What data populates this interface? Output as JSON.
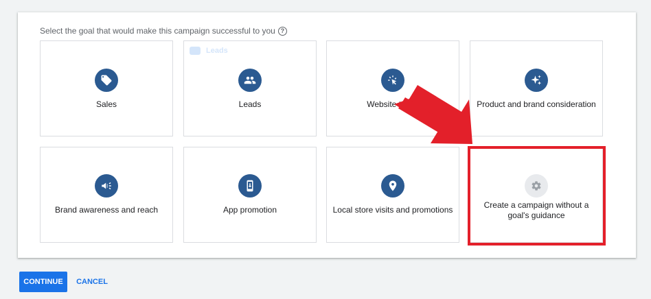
{
  "prompt": {
    "text": "Select the goal that would make this campaign successful to you",
    "help_icon": "help-circle-icon"
  },
  "goals": [
    {
      "label": "Sales",
      "icon": "tag-icon"
    },
    {
      "label": "Leads",
      "icon": "people-icon",
      "hover_preview": {
        "title": "Leads"
      }
    },
    {
      "label": "Website traffic",
      "icon": "cursor-click-icon"
    },
    {
      "label": "Product and brand consideration",
      "icon": "sparkle-icon"
    },
    {
      "label": "Brand awareness and reach",
      "icon": "megaphone-icon"
    },
    {
      "label": "App promotion",
      "icon": "phone-download-icon"
    },
    {
      "label": "Local store visits and promotions",
      "icon": "map-pin-icon"
    },
    {
      "label": "Create a campaign without a goal's guidance",
      "icon": "gear-icon",
      "highlighted": true
    }
  ],
  "actions": {
    "continue_label": "CONTINUE",
    "cancel_label": "CANCEL"
  },
  "colors": {
    "icon_bg": "#2b5a91",
    "accent": "#1a73e8",
    "highlight": "#e3202a"
  }
}
